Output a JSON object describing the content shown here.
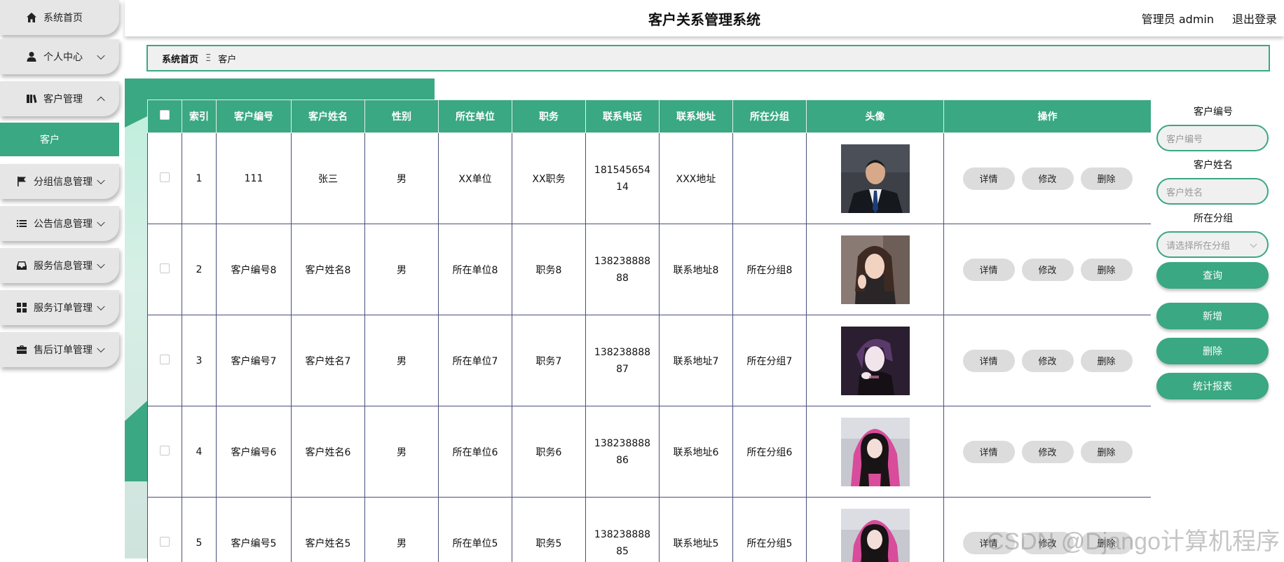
{
  "header": {
    "title": "客户关系管理系统",
    "user": "管理员 admin",
    "logout": "退出登录"
  },
  "sidebar": {
    "items": [
      {
        "label": "系统首页",
        "icon": "home-icon"
      },
      {
        "label": "个人中心",
        "icon": "user-icon"
      },
      {
        "label": "客户管理",
        "icon": "book-icon"
      },
      {
        "label": "分组信息管理",
        "icon": "flag-icon"
      },
      {
        "label": "公告信息管理",
        "icon": "list-icon"
      },
      {
        "label": "服务信息管理",
        "icon": "inbox-icon"
      },
      {
        "label": "服务订单管理",
        "icon": "grid-icon"
      },
      {
        "label": "售后订单管理",
        "icon": "briefcase-icon"
      }
    ],
    "sub_item": "客户",
    "accent": "#3aa882"
  },
  "breadcrumb": {
    "home": "系统首页",
    "separator": "Ξ",
    "current": "客户"
  },
  "table": {
    "headers": [
      "",
      "索引",
      "客户编号",
      "客户姓名",
      "性别",
      "所在单位",
      "职务",
      "联系电话",
      "联系地址",
      "所在分组",
      "头像",
      "操作"
    ],
    "rows": [
      {
        "index": "1",
        "code": "111",
        "name": "张三",
        "gender": "男",
        "unit": "XX单位",
        "job": "XX职务",
        "phone": "18154565414",
        "address": "XXX地址",
        "group": "",
        "avatar": "avatar-man-suit"
      },
      {
        "index": "2",
        "code": "客户编号8",
        "name": "客户姓名8",
        "gender": "男",
        "unit": "所在单位8",
        "job": "职务8",
        "phone": "13823888888",
        "address": "联系地址8",
        "group": "所在分组8",
        "avatar": "avatar-woman-dark-hair"
      },
      {
        "index": "3",
        "code": "客户编号7",
        "name": "客户姓名7",
        "gender": "男",
        "unit": "所在单位7",
        "job": "职务7",
        "phone": "13823888887",
        "address": "联系地址7",
        "group": "所在分组7",
        "avatar": "avatar-woman-dark"
      },
      {
        "index": "4",
        "code": "客户编号6",
        "name": "客户姓名6",
        "gender": "男",
        "unit": "所在单位6",
        "job": "职务6",
        "phone": "13823888886",
        "address": "联系地址6",
        "group": "所在分组6",
        "avatar": "avatar-woman-pink-hoodie"
      },
      {
        "index": "5",
        "code": "客户编号5",
        "name": "客户姓名5",
        "gender": "男",
        "unit": "所在单位5",
        "job": "职务5",
        "phone": "13823888885",
        "address": "联系地址5",
        "group": "所在分组5",
        "avatar": "avatar-woman-pink-hoodie"
      }
    ],
    "actions": {
      "detail": "详情",
      "edit": "修改",
      "delete": "删除"
    }
  },
  "search": {
    "code_label": "客户编号",
    "code_placeholder": "客户编号",
    "name_label": "客户姓名",
    "name_placeholder": "客户姓名",
    "group_label": "所在分组",
    "group_placeholder": "请选择所在分组",
    "query": "查询",
    "add": "新增",
    "delete": "删除",
    "report": "统计报表"
  },
  "watermark": "CSDN @Django计算机程序"
}
